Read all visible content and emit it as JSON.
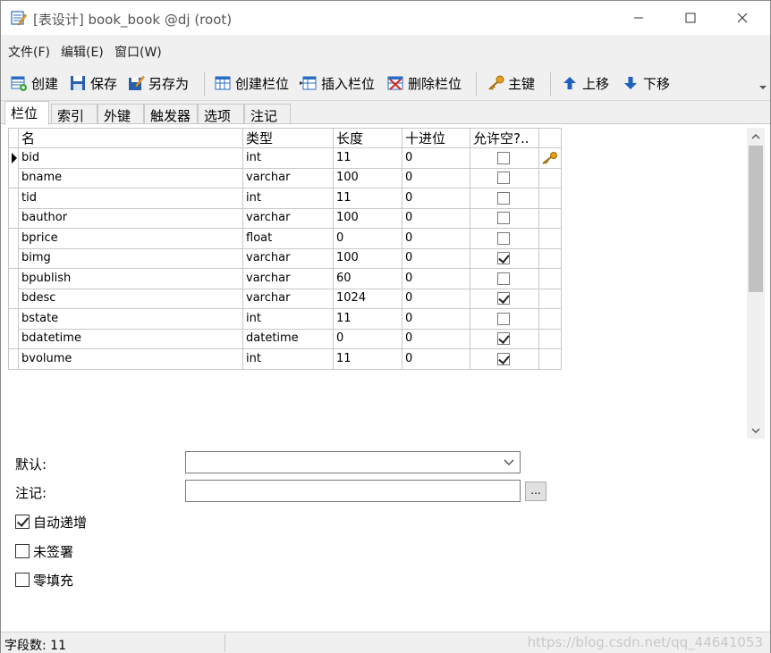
{
  "window": {
    "title": "[表设计] book_book @dj (root)"
  },
  "menu": [
    "文件(F)",
    "编辑(E)",
    "窗口(W)"
  ],
  "toolbar": {
    "create": "创建",
    "save": "保存",
    "save_as": "另存为",
    "create_field": "创建栏位",
    "insert_field": "插入栏位",
    "delete_field": "删除栏位",
    "primary_key": "主键",
    "move_up": "上移",
    "move_down": "下移"
  },
  "tabs": [
    "栏位",
    "索引",
    "外键",
    "触发器",
    "选项",
    "注记"
  ],
  "grid": {
    "headers": [
      "名",
      "类型",
      "长度",
      "十进位",
      "允许空?..",
      ""
    ],
    "rows": [
      {
        "name": "bid",
        "type": "int",
        "length": "11",
        "decimals": "0",
        "nullable": false,
        "key": true
      },
      {
        "name": "bname",
        "type": "varchar",
        "length": "100",
        "decimals": "0",
        "nullable": false,
        "key": false
      },
      {
        "name": "tid",
        "type": "int",
        "length": "11",
        "decimals": "0",
        "nullable": false,
        "key": false
      },
      {
        "name": "bauthor",
        "type": "varchar",
        "length": "100",
        "decimals": "0",
        "nullable": false,
        "key": false
      },
      {
        "name": "bprice",
        "type": "float",
        "length": "0",
        "decimals": "0",
        "nullable": false,
        "key": false
      },
      {
        "name": "bimg",
        "type": "varchar",
        "length": "100",
        "decimals": "0",
        "nullable": true,
        "key": false
      },
      {
        "name": "bpublish",
        "type": "varchar",
        "length": "60",
        "decimals": "0",
        "nullable": false,
        "key": false
      },
      {
        "name": "bdesc",
        "type": "varchar",
        "length": "1024",
        "decimals": "0",
        "nullable": true,
        "key": false
      },
      {
        "name": "bstate",
        "type": "int",
        "length": "11",
        "decimals": "0",
        "nullable": false,
        "key": false
      },
      {
        "name": "bdatetime",
        "type": "datetime",
        "length": "0",
        "decimals": "0",
        "nullable": true,
        "key": false
      },
      {
        "name": "bvolume",
        "type": "int",
        "length": "11",
        "decimals": "0",
        "nullable": true,
        "key": false
      }
    ]
  },
  "properties": {
    "default_label": "默认:",
    "default_value": "",
    "comment_label": "注记:",
    "comment_value": "",
    "ellipsis": "...",
    "options": [
      {
        "label": "自动递增",
        "checked": true
      },
      {
        "label": "未签署",
        "checked": false
      },
      {
        "label": "零填充",
        "checked": false
      }
    ]
  },
  "status": {
    "field_count": "字段数: 11",
    "watermark": "https://blog.csdn.net/qq_44641053"
  },
  "colors": {
    "key_icon": "#e0a020",
    "arrow_icon": "#1f5fbf"
  }
}
